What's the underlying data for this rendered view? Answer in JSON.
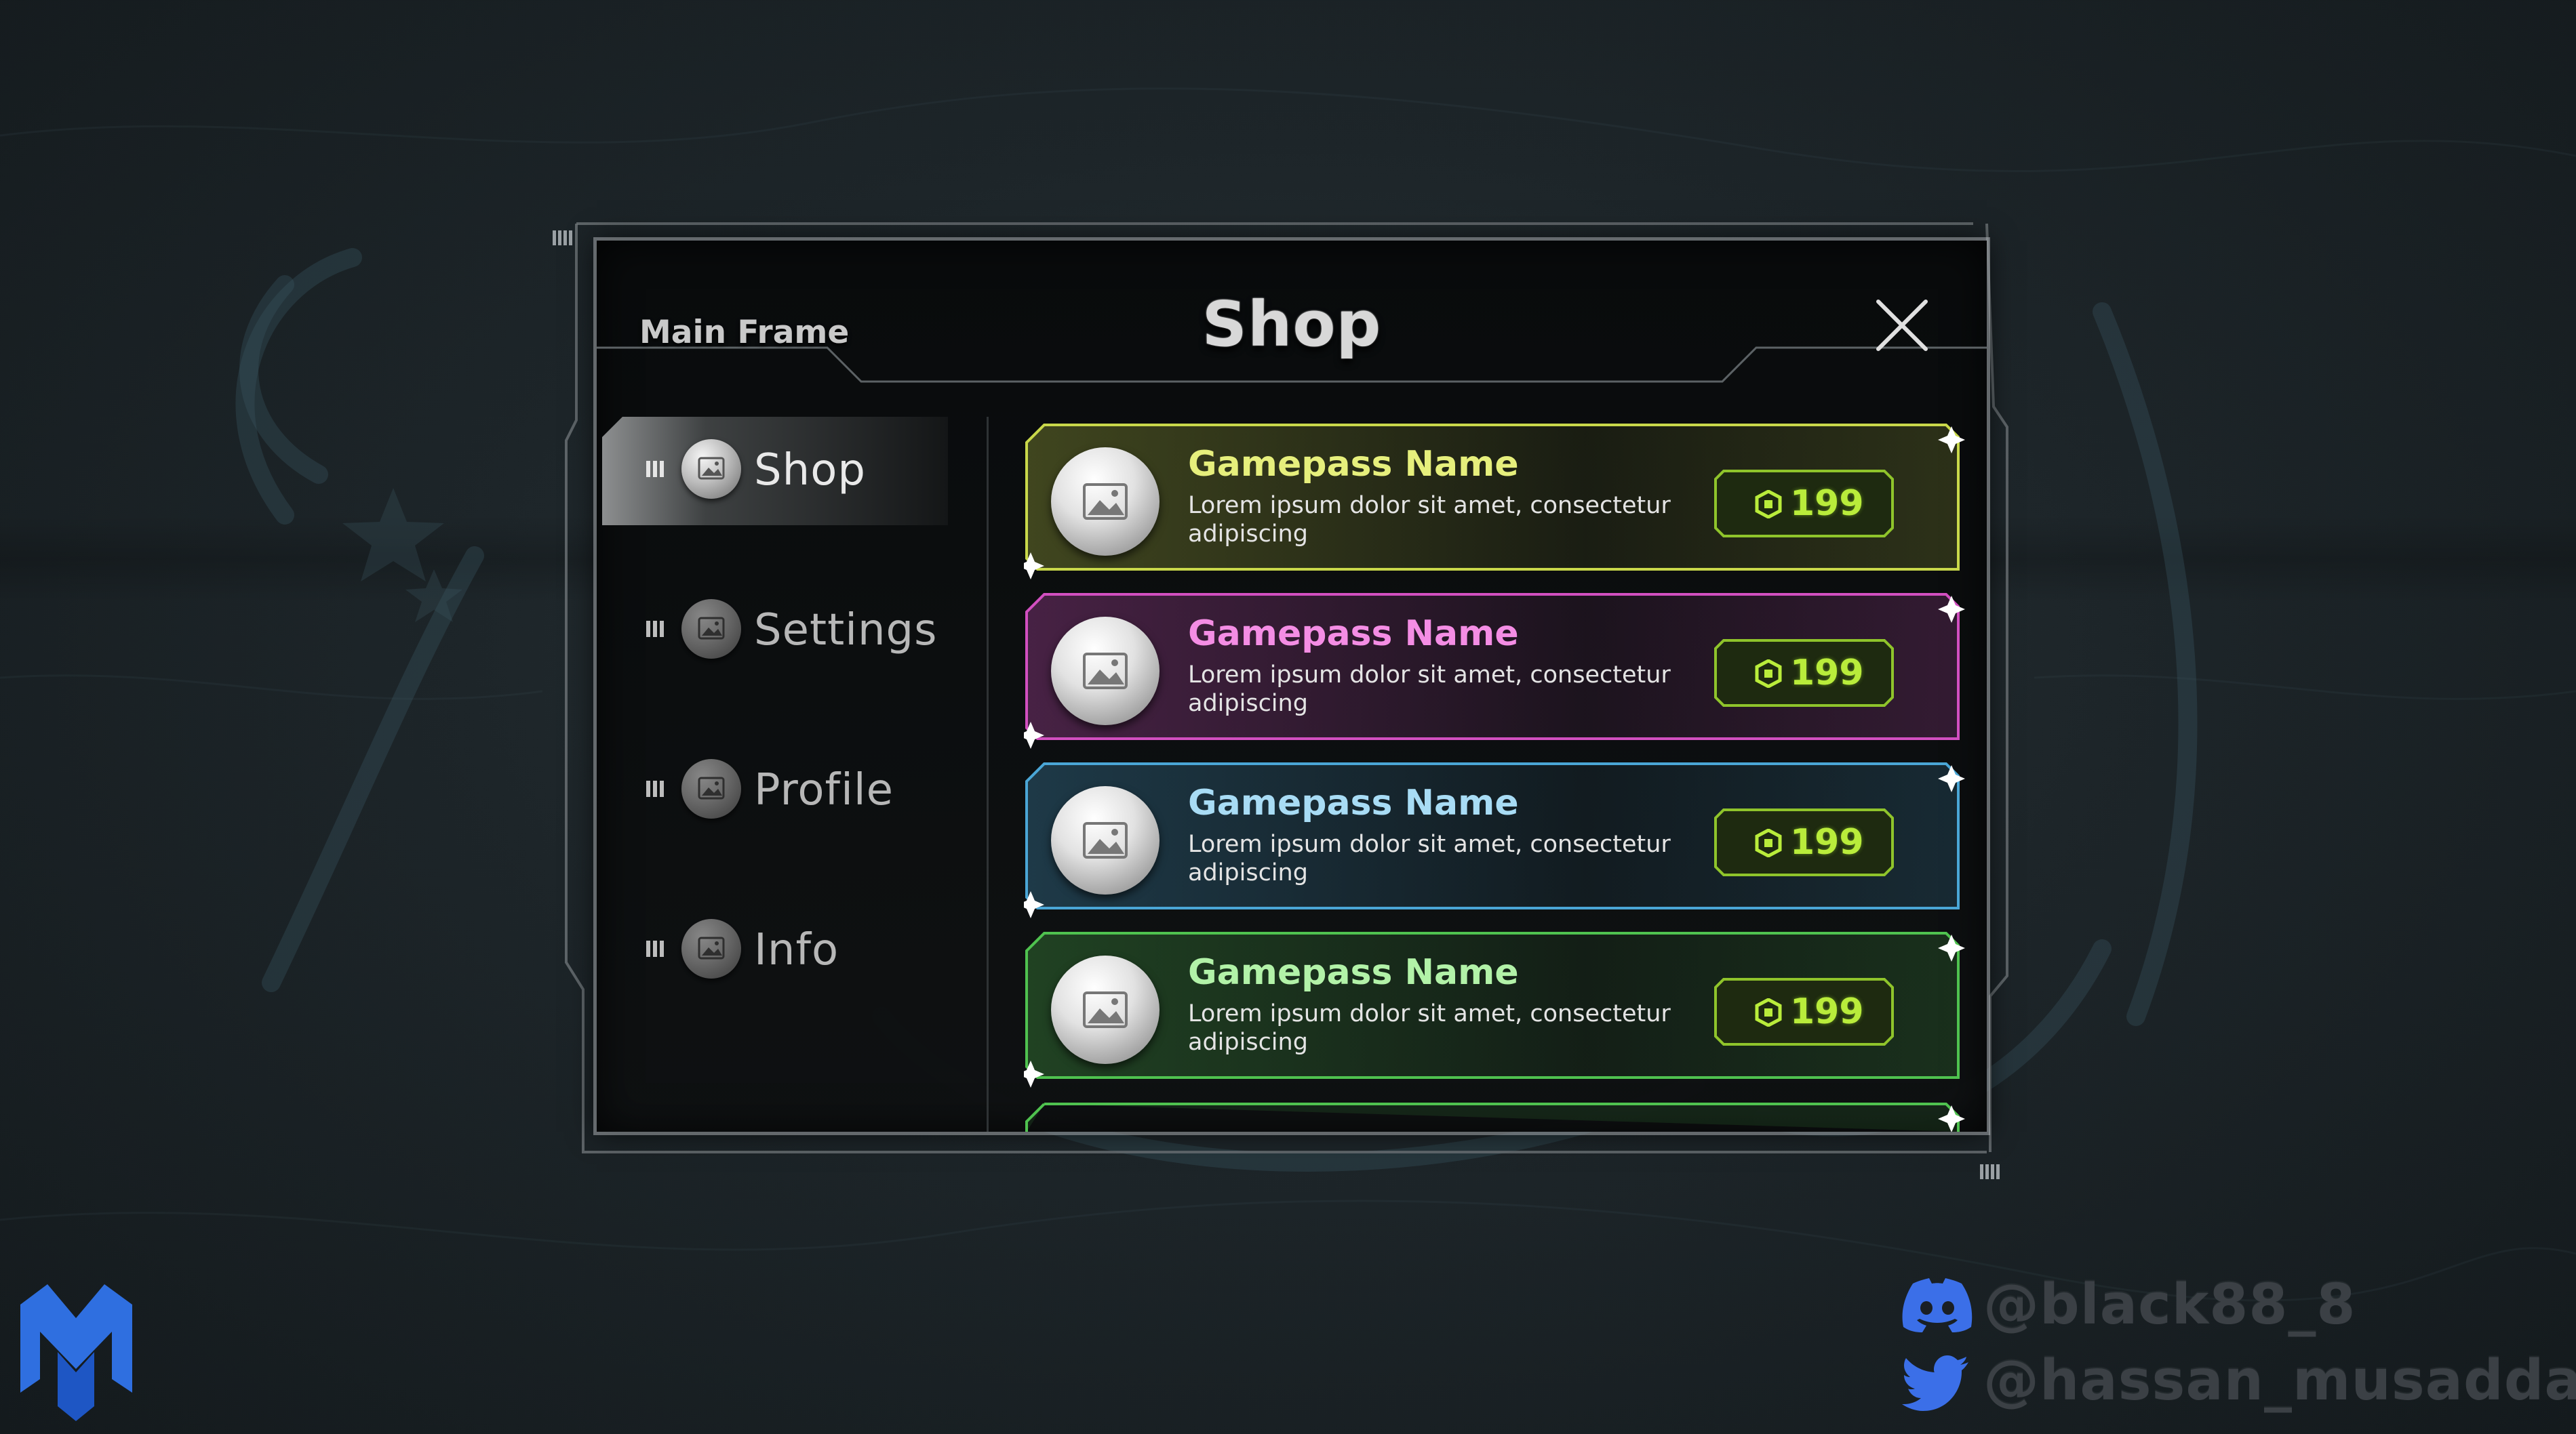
{
  "window": {
    "frame_label": "Main Frame",
    "title": "Shop"
  },
  "sidebar": {
    "items": [
      {
        "label": "Shop",
        "active": true
      },
      {
        "label": "Settings",
        "active": false
      },
      {
        "label": "Profile",
        "active": false
      },
      {
        "label": "Info",
        "active": false
      }
    ]
  },
  "cards": [
    {
      "name": "Gamepass Name",
      "desc": "Lorem ipsum dolor sit amet, consectetur adipiscing",
      "price": "199",
      "accent": "#c9d84a",
      "name_color": "#e6ef7c"
    },
    {
      "name": "Gamepass Name",
      "desc": "Lorem ipsum dolor sit amet, consectetur adipiscing",
      "price": "199",
      "accent": "#d24fc0",
      "name_color": "#f48de4"
    },
    {
      "name": "Gamepass Name",
      "desc": "Lorem ipsum dolor sit amet, consectetur adipiscing",
      "price": "199",
      "accent": "#4aa6d6",
      "name_color": "#a8dcf5"
    },
    {
      "name": "Gamepass Name",
      "desc": "Lorem ipsum dolor sit amet, consectetur adipiscing",
      "price": "199",
      "accent": "#4fc24f",
      "name_color": "#b2f2a8"
    }
  ],
  "socials": {
    "discord": "@black88_8",
    "twitter": "@hassan_musaddaq"
  },
  "colors": {
    "price_green": "#b9ec3b",
    "logo_blue": "#2f6fe0"
  }
}
